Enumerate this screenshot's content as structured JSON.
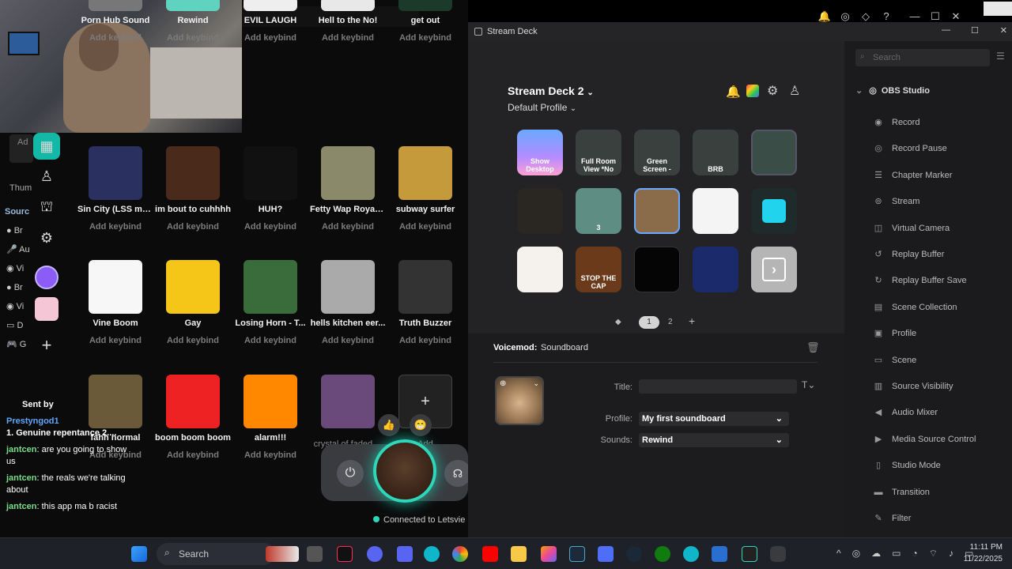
{
  "soundboard": {
    "tiles": [
      {
        "name": "Porn Hub Sound",
        "keybind": "Add keybind"
      },
      {
        "name": "Rewind",
        "keybind": "Add keybind"
      },
      {
        "name": "EVIL LAUGH",
        "keybind": "Add keybind"
      },
      {
        "name": "Hell to the No!",
        "keybind": "Add keybind"
      },
      {
        "name": "get out",
        "keybind": "Add keybind"
      },
      {
        "name": "Sin City (LSS me...",
        "keybind": "Add keybind"
      },
      {
        "name": "im bout to cuhhhh",
        "keybind": "Add keybind"
      },
      {
        "name": "HUH?",
        "keybind": "Add keybind"
      },
      {
        "name": "Fetty Wap Royal ...",
        "keybind": "Add keybind"
      },
      {
        "name": "subway surfer",
        "keybind": "Add keybind"
      },
      {
        "name": "Vine Boom",
        "keybind": "Add keybind"
      },
      {
        "name": "Gay",
        "keybind": "Add keybind"
      },
      {
        "name": "Losing Horn - T...",
        "keybind": "Add keybind"
      },
      {
        "name": "hells kitchen eer...",
        "keybind": "Add keybind"
      },
      {
        "name": "Truth Buzzer",
        "keybind": "Add keybind"
      },
      {
        "name": "fahh normal",
        "keybind": "Add keybind"
      },
      {
        "name": "boom boom boom",
        "keybind": "Add keybind"
      },
      {
        "name": "alarm!!!",
        "keybind": "Add keybind"
      },
      {
        "name": "crystal of faded ...",
        "keybind": ""
      },
      {
        "name": "Add",
        "keybind": ""
      }
    ],
    "connection_status": "Connected to Letsvie",
    "stray_text": "Ad",
    "thumb_text": "Thum",
    "sources_label": "Sourc",
    "side_labels": [
      "Br",
      "Au",
      "Vi",
      "Br",
      "Vi",
      "D",
      "G"
    ],
    "chat": {
      "header": "Sent by",
      "messages": [
        {
          "user": "Prestyngod1",
          "text": "1. Genuine repentance 2...."
        },
        {
          "user": "jantcen",
          "text": ": are you going to show us"
        },
        {
          "user": "jantcen",
          "text": ": the reals we're talking about"
        },
        {
          "user": "jantcen",
          "text": ": this app ma b racist"
        }
      ]
    }
  },
  "stream_deck": {
    "window_title": "Stream Deck",
    "device_name": "Stream Deck 2",
    "profile": "Default Profile",
    "keys": [
      {
        "label": "Show Desktop"
      },
      {
        "label": "Full Room View *No"
      },
      {
        "label": "Green Screen -"
      },
      {
        "label": "BRB"
      },
      {
        "label": ""
      },
      {
        "label": ""
      },
      {
        "label": "3"
      },
      {
        "label": ""
      },
      {
        "label": ""
      },
      {
        "label": ""
      },
      {
        "label": ""
      },
      {
        "label": "STOP THE CAP"
      },
      {
        "label": ""
      },
      {
        "label": ""
      },
      {
        "label": ""
      }
    ],
    "pages": [
      "1",
      "2"
    ],
    "detail": {
      "plugin": "Voicemod:",
      "action": "Soundboard",
      "title_label": "Title:",
      "title_value": "",
      "profile_label": "Profile:",
      "profile_value": "My first soundboard",
      "sounds_label": "Sounds:",
      "sounds_value": "Rewind"
    },
    "search_placeholder": "Search",
    "category": "OBS Studio",
    "actions": [
      "Record",
      "Record Pause",
      "Chapter Marker",
      "Stream",
      "Virtual Camera",
      "Replay Buffer",
      "Replay Buffer Save",
      "Scene Collection",
      "Profile",
      "Scene",
      "Source Visibility",
      "Audio Mixer",
      "Media Source Control",
      "Studio Mode",
      "Transition",
      "Filter"
    ]
  },
  "taskbar": {
    "search_placeholder": "Search",
    "time": "11:11 PM",
    "date": "11/22/2025"
  }
}
